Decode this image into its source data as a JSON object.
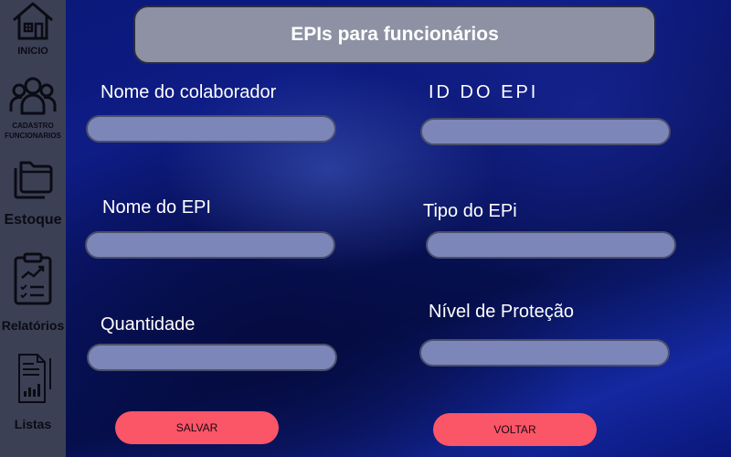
{
  "sidebar": {
    "items": [
      {
        "label": "INICIO",
        "icon": "home-icon"
      },
      {
        "label": "CADASTRO FUNCIONARIOS",
        "icon": "users-icon"
      },
      {
        "label": "Estoque",
        "icon": "folders-icon"
      },
      {
        "label": "Relatórios",
        "icon": "report-clipboard-icon"
      },
      {
        "label": "Listas",
        "icon": "list-document-icon"
      }
    ]
  },
  "header": {
    "title": "EPIs para funcionários"
  },
  "form": {
    "nome_colaborador": {
      "label": "Nome do colaborador",
      "value": ""
    },
    "id_epi": {
      "label": "ID DO EPI",
      "value": ""
    },
    "nome_epi": {
      "label": "Nome do EPI",
      "value": ""
    },
    "tipo_epi": {
      "label": "Tipo do EPi",
      "value": ""
    },
    "quantidade": {
      "label": "Quantidade",
      "value": ""
    },
    "nivel_protecao": {
      "label": "Nível de Proteção",
      "value": ""
    }
  },
  "actions": {
    "save_label": "SALVAR",
    "back_label": "VOLTAR"
  },
  "colors": {
    "sidebar": "#3b4055",
    "button": "#fb5568",
    "input": "#7d86b8",
    "title_bar": "#8d91a3"
  }
}
